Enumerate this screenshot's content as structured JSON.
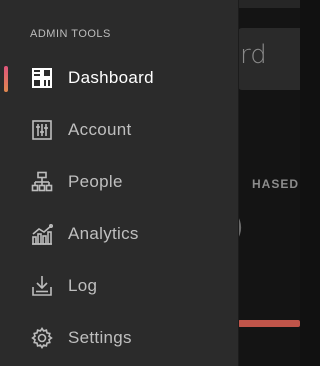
{
  "background": {
    "title_fragment": "rd",
    "label_fragment": "HASED",
    "value_fragment": ")"
  },
  "drawer": {
    "section_label": "ADMIN TOOLS",
    "items": [
      {
        "label": "Dashboard",
        "icon": "dashboard-icon",
        "active": true
      },
      {
        "label": "Account",
        "icon": "account-icon",
        "active": false
      },
      {
        "label": "People",
        "icon": "people-icon",
        "active": false
      },
      {
        "label": "Analytics",
        "icon": "analytics-icon",
        "active": false
      },
      {
        "label": "Log",
        "icon": "log-icon",
        "active": false
      },
      {
        "label": "Settings",
        "icon": "settings-icon",
        "active": false
      }
    ]
  },
  "colors": {
    "accent_start": "#e0557c",
    "accent_end": "#e0894f",
    "drawer_bg": "#2b2b2b"
  }
}
